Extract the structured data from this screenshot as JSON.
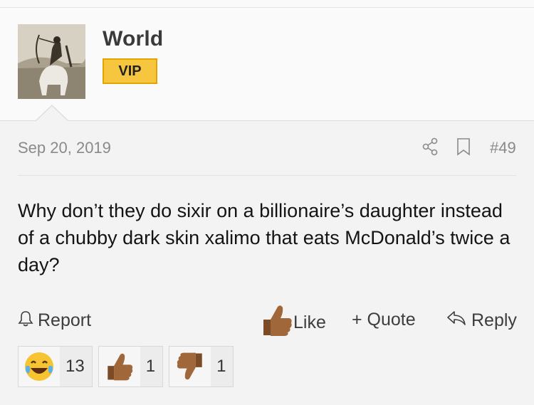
{
  "user": {
    "name": "World",
    "badge": "VIP"
  },
  "post": {
    "date": "Sep 20, 2019",
    "number": "#49",
    "text": "Why don’t they do sixir on a billionaire’s daughter instead of a chubby dark skin xalimo that eats McDonald’s twice a day?"
  },
  "actions": {
    "report": "Report",
    "like": "Like",
    "quote": "+ Quote",
    "reply": "Reply"
  },
  "reactions": [
    {
      "icon": "laughing-tears-emoji",
      "count": "13"
    },
    {
      "icon": "thumbs-up-emoji",
      "count": "1"
    },
    {
      "icon": "thumbs-down-emoji",
      "count": "1"
    }
  ],
  "colors": {
    "badge": "#f6c73e",
    "text": "#141414",
    "muted": "#8a8a8a"
  }
}
